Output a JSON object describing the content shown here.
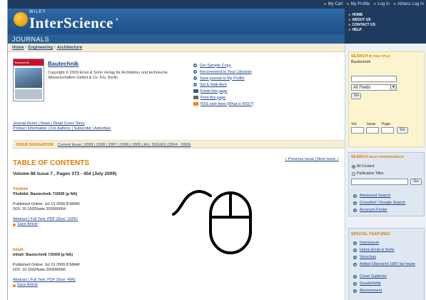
{
  "top_links": [
    "My Cart",
    "My Profile",
    "Log In",
    "Athens Log In"
  ],
  "brand": {
    "publisher": "WILEY",
    "name": "InterScience",
    "section": "JOURNALS"
  },
  "right_nav": [
    "HOME",
    "ABOUT US",
    "CONTACT US",
    "HELP"
  ],
  "breadcrumb": [
    "Home",
    "Engineering",
    "Architecture"
  ],
  "journal": {
    "cover_head": "Bautechnik",
    "title": "Bautechnik",
    "copyright": "Copyright © 2009 Ernst & Sohn Verlag für Architektur und technische Wissenschaften GmbH & Co. KG, Berlin"
  },
  "actions": [
    "Get Sample Copy",
    "Recommend to Your Librarian",
    "Save journal to My Profile",
    "Set E-Mail Alert",
    "Email this page",
    "Print this page",
    "RSS web feed (What is RSS?)"
  ],
  "journal_links": {
    "line1": "Journal Home | News | Read Cover Story",
    "line2": "Product Information | For Authors | Subscribe | Advertise"
  },
  "issue_nav": {
    "label": "ISSUE NAVIGATION",
    "links": "Current Issue | 2009 | 2008 | 2007 | 2006 | 2005 | ALL ISSUES (2004 - 2009)"
  },
  "prev_next": "« Previous Issue | Next Issue »",
  "toc": {
    "title": "TABLE OF CONTENTS",
    "volume": "Volume 86 Issue 7 , Pages 373 - 454 (July 2009)"
  },
  "articles": [
    {
      "section": "Titelbild",
      "title": "Titelbild: Bautechnik 7/2009 (p NA)",
      "published": "Published Online: Jul 13 2009 8:58AM",
      "doi": "DOI: 10.1002/bate.200990094",
      "links": "Abstract | Full Text: PDF (Size: 192K)",
      "save": "Save Article"
    },
    {
      "section": "Inhalt",
      "title": "Inhalt: Bautechnik 7/2009 (p NA)",
      "published": "Published Online: Jul 13 2009 8:58AM",
      "doi": "DOI: 10.1002/bate.200990096",
      "links": "Abstract | Full Text: PDF (Size: 49K)",
      "save": "Save Article"
    }
  ],
  "search_title": {
    "heading": "SEARCH",
    "heading_small": "IN THIS TITLE",
    "journal": "Bautechnik",
    "field": "All Fields",
    "go": "Go",
    "vol_label": "Vol:",
    "issue_label": "Issue:",
    "page_label": "Page:"
  },
  "search_wiley": {
    "heading": "SEARCH",
    "heading_small": "WILEY INTERSCIENCE",
    "opt1": "All Content",
    "opt2": "Publication Titles",
    "go": "Go",
    "links": [
      "Advanced Search",
      "CrossRef / Google Search",
      "Acronym Finder"
    ]
  },
  "special_features": {
    "heading": "SPECIAL FEATURES",
    "items": [
      "Impressum",
      "Home Ernst & Sohn",
      "Vorschau",
      "Artikel-Übersicht 1987 bis heute",
      "Cover Galleries",
      "Sonderhefte",
      "Abonnement"
    ]
  },
  "colors": {
    "accent": "#e07b00",
    "header": "#1f3a5f",
    "link": "#1a3f8f"
  }
}
